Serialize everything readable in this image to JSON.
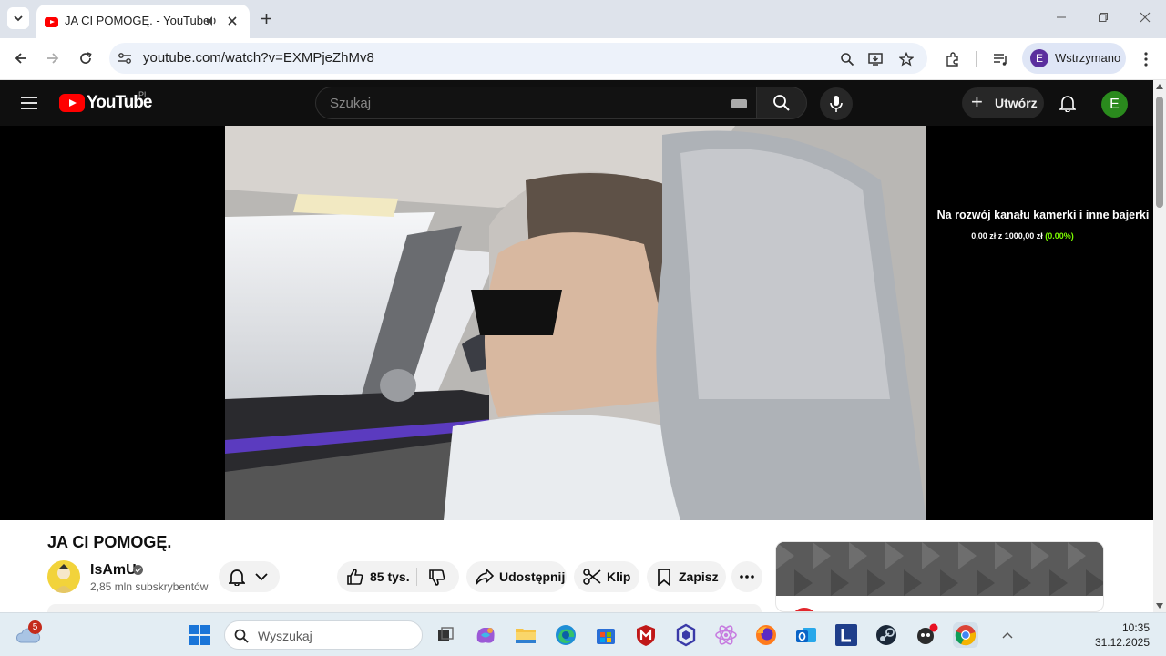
{
  "browser": {
    "tab": {
      "title": "JA CI POMOGĘ. - YouTube"
    },
    "url": "youtube.com/watch?v=EXMPjeZhMv8",
    "profile_label": "Wstrzymano",
    "profile_initial": "E"
  },
  "youtube": {
    "logo_text": "YouTube",
    "country_code": "PL",
    "search_placeholder": "Szukaj",
    "create_label": "Utwórz",
    "account_initial": "E"
  },
  "player": {
    "overlay_title": "Na rozwój kanału kamerki i inne bajerki",
    "overlay_amount_prefix": "0,00 zł z 1000,00 zł",
    "overlay_amount_pct": "(0.00%)"
  },
  "video": {
    "title": "JA CI POMOGĘ.",
    "channel_name": "IsAmU",
    "subscribers": "2,85 mln subskrybentów",
    "like_count": "85 tys.",
    "share_label": "Udostępnij",
    "clip_label": "Klip",
    "save_label": "Zapisz"
  },
  "taskbar": {
    "weather_badge": "5",
    "search_placeholder": "Wyszukaj",
    "time": "10:35",
    "date": "31.12.2025"
  },
  "colors": {
    "youtube_red": "#ff0000",
    "header_bg": "#0f0f0f",
    "progress_green": "#7CFC00",
    "account_green": "#2a8a1d",
    "profile_purple": "#5b2f9e"
  }
}
